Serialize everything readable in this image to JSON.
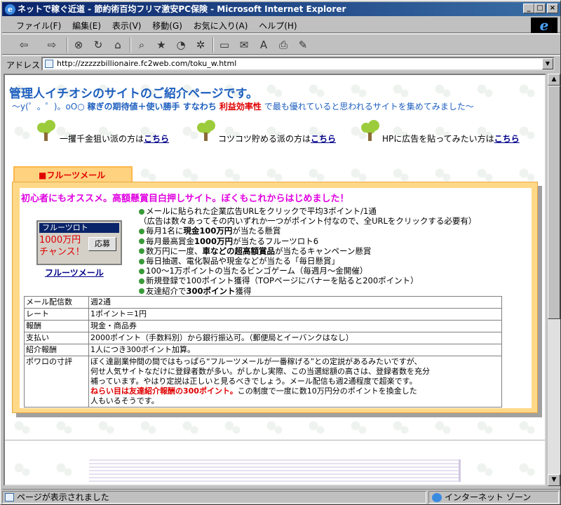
{
  "window": {
    "title": "ネットで稼ぐ近道 - 節約術百均フリマ激安PC保険 - Microsoft Internet Explorer"
  },
  "menu": [
    "ファイル(F)",
    "編集(E)",
    "表示(V)",
    "移動(G)",
    "お気に入り(A)",
    "ヘルプ(H)"
  ],
  "toolbar_icons": [
    "back-icon",
    "forward-icon",
    "stop-icon",
    "refresh-icon",
    "home-icon",
    "search-icon",
    "favorites-icon",
    "history-icon",
    "channels-icon",
    "fullscreen-icon",
    "mail-icon",
    "font-icon",
    "print-icon",
    "edit-icon"
  ],
  "address": {
    "label": "アドレス",
    "url": "http://zzzzzbillionaire.fc2web.com/toku_w.html"
  },
  "page": {
    "title": "管理人イチオシのサイトのご紹介ページです。",
    "subtitle": {
      "prefix": "～y(゜。゜)。oO○ ",
      "bold1": "稼ぎの期待値＋使い勝手 すなわち",
      "red": " 利益効率性",
      "rest": " で最も優れていると思われるサイトを集めてみました～"
    },
    "nav": [
      {
        "text": "一攫千金狙い派の方は",
        "link": "こちら"
      },
      {
        "text": "コツコツ貯める派の方は",
        "link": "こちら"
      },
      {
        "text": "HPに広告を貼ってみたい方は",
        "link": "こちら"
      }
    ]
  },
  "section": {
    "tab_label": "■フルーツメール",
    "headline": "初心者にもオススメ。高額懸賞目白押しサイト。ぼくもこれからはじめました！",
    "banner": {
      "title": "フルーツロト",
      "line1": "1000万円",
      "line2": "チャンス！",
      "button": "応募",
      "link": "フルーツメール"
    },
    "features": [
      {
        "a": "メールに貼られた企業広告URLをクリックで平均3ポイント/1通",
        "b": "",
        "c": ""
      },
      {
        "a": "（広告は数々あってその内いずれか一つがポイント付なので、全URLをクリックする必要有）",
        "b": "",
        "c": ""
      },
      {
        "a": "毎月1名に",
        "b": "現金100万円",
        "c": "が当たる懸賞"
      },
      {
        "a": "毎月最高賞金",
        "b": "1000万円",
        "c": "が当たるフルーツロト6"
      },
      {
        "a": "数万円に一度、",
        "b": "車などの超高額賞品",
        "c": "が当たるキャンペーン懸賞"
      },
      {
        "a": "毎日抽選、電化製品や現金などが当たる「毎日懸賞」",
        "b": "",
        "c": ""
      },
      {
        "a": "100～1万ポイントの当たるビンゴゲーム（毎週月～金開催）",
        "b": "",
        "c": ""
      },
      {
        "a": "新規登録で100ポイント獲得（TOPページにバナーを貼ると200ポイント）",
        "b": "",
        "c": ""
      },
      {
        "a": "友達紹介で",
        "b": "300ポイント",
        "c": "獲得"
      }
    ],
    "table": [
      {
        "k": "メール配信数",
        "v": "週2通"
      },
      {
        "k": "レート",
        "v": "1ポイント＝1円"
      },
      {
        "k": "報酬",
        "v": "現金・商品券"
      },
      {
        "k": "支払い",
        "v": "2000ポイント（手数料別）から銀行振込可。（郵便局とイーバンクはなし）"
      },
      {
        "k": "紹介報酬",
        "v": "1人につき300ポイント加算。"
      }
    ],
    "review": {
      "key": "ポワロの寸評",
      "line1": "ぼく達副業仲間の間ではもっぱら“フルーツメールが一番稼げる”との定説があるみたいですが、",
      "line2": "何せ人気サイトなだけに登録者数が多い。がしかし実際、この当選総額の高さは、登録者数を充分",
      "line3": "補っています。やはり定説は正しいと見るべきでしょう。メール配信も週2通程度で超楽です。",
      "red": "ねらい目は友達紹介報酬の300ポイント。",
      "line4_rest": "この制度で一度に数10万円分のポイントを換金した",
      "line5": "人もいるそうです。"
    }
  },
  "status": {
    "left": "ページが表示されました",
    "right": "インターネット ゾーン"
  }
}
